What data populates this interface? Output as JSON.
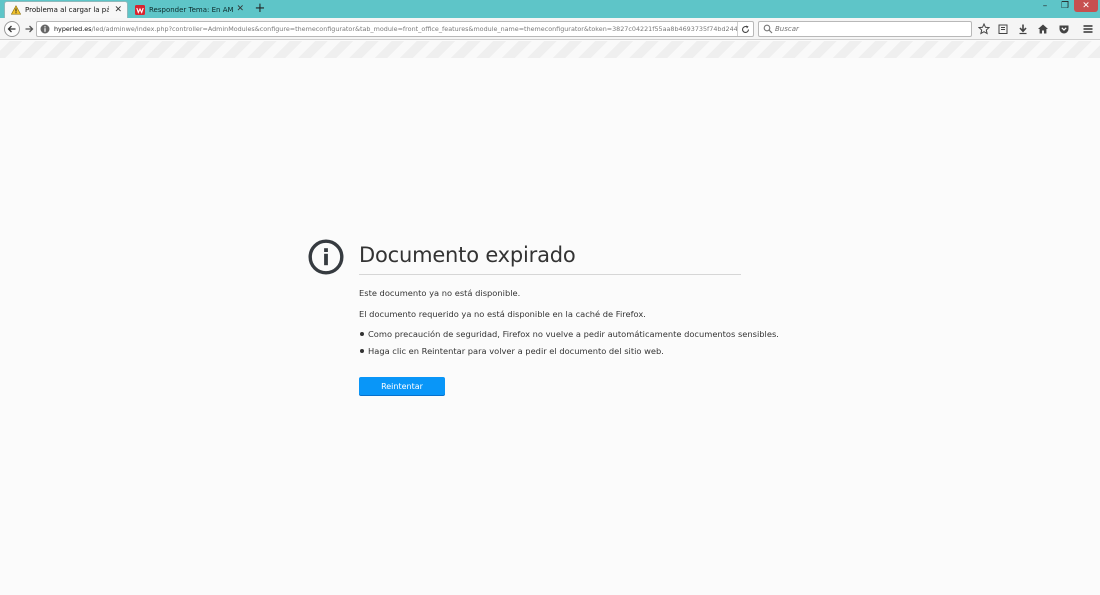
{
  "tabs": [
    {
      "title": "Problema al cargar la pági...",
      "icon": "warning-icon",
      "active": true
    },
    {
      "title": "Responder Tema: En AMA...",
      "icon": "site-favicon",
      "active": false
    }
  ],
  "newtab_label": "+",
  "window_controls": {
    "minimize": "–",
    "maximize": "❐",
    "close": "✕"
  },
  "navbar": {
    "url_host": "hyperled.es",
    "url_path": "/led/adminwe/index.php?controller=AdminModules&configure=themeconfigurator&tab_module=front_office_features&module_name=themeconfigurator&token=3827c04221f55aa8b4693735f74bd244",
    "search_placeholder": "Buscar"
  },
  "error": {
    "title": "Documento expirado",
    "paragraph1": "Este documento ya no está disponible.",
    "paragraph2": "El documento requerido ya no está disponible en la caché de Firefox.",
    "bullets": [
      "Como precaución de seguridad, Firefox no vuelve a pedir automáticamente documentos sensibles.",
      "Haga clic en Reintentar para volver a pedir el documento del sitio web."
    ],
    "retry_label": "Reintentar"
  },
  "colors": {
    "tabstrip": "#5ec5c8",
    "button": "#0996f8",
    "close": "#c75050"
  }
}
